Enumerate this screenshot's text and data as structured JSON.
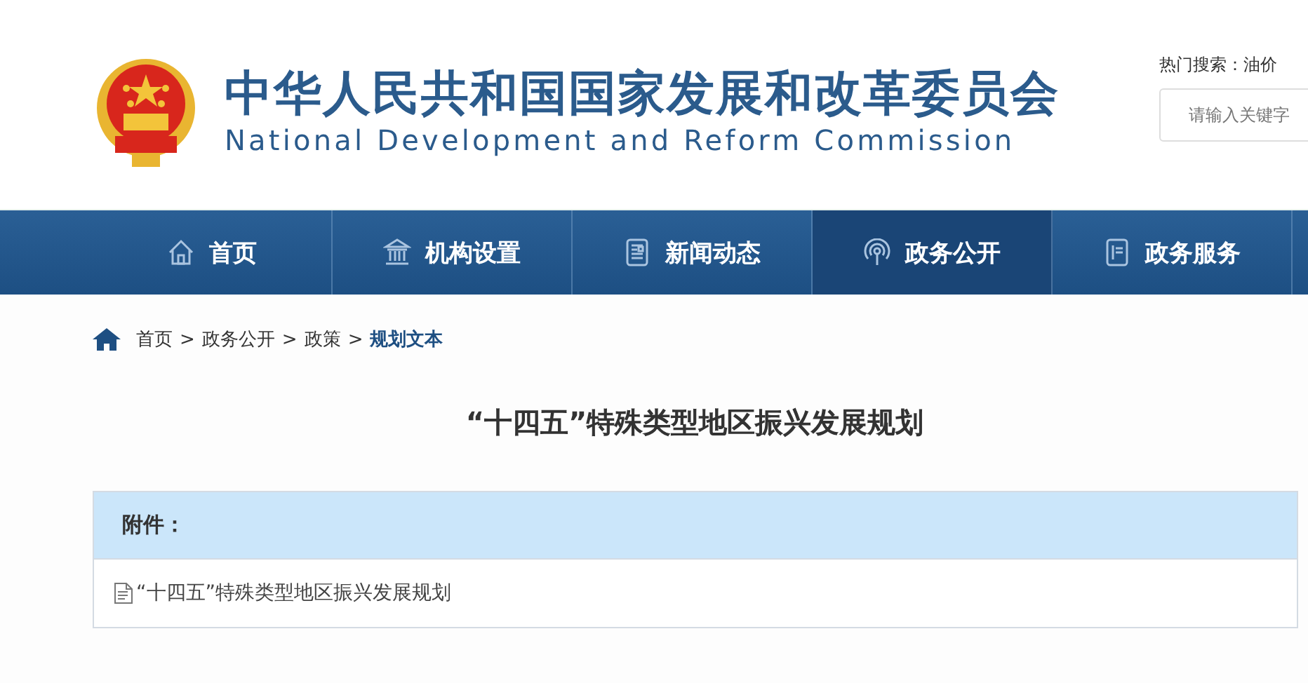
{
  "header": {
    "title_cn": "中华人民共和国国家发展和改革委员会",
    "title_en": "National Development and Reform Commission",
    "hot_search_label": "热门搜索：",
    "hot_search_term": "油价",
    "search": {
      "placeholder": "请输入关键字"
    }
  },
  "nav": [
    {
      "label": "首页",
      "kind": "home",
      "selected": false
    },
    {
      "label": "机构设置",
      "kind": "building",
      "selected": false
    },
    {
      "label": "新闻动态",
      "kind": "news",
      "selected": false
    },
    {
      "label": "政务公开",
      "kind": "signal",
      "selected": true
    },
    {
      "label": "政务服务",
      "kind": "doc",
      "selected": false
    }
  ],
  "breadcrumb": [
    {
      "label": "首页",
      "current": false
    },
    {
      "label": "政务公开",
      "current": false
    },
    {
      "label": "政策",
      "current": false
    },
    {
      "label": "规划文本",
      "current": true
    }
  ],
  "breadcrumb_separator": ">",
  "article_title": "“十四五”特殊类型地区振兴发展规划",
  "attachments": {
    "heading": "附件：",
    "files": [
      "“十四五”特殊类型地区振兴发展规划"
    ]
  }
}
